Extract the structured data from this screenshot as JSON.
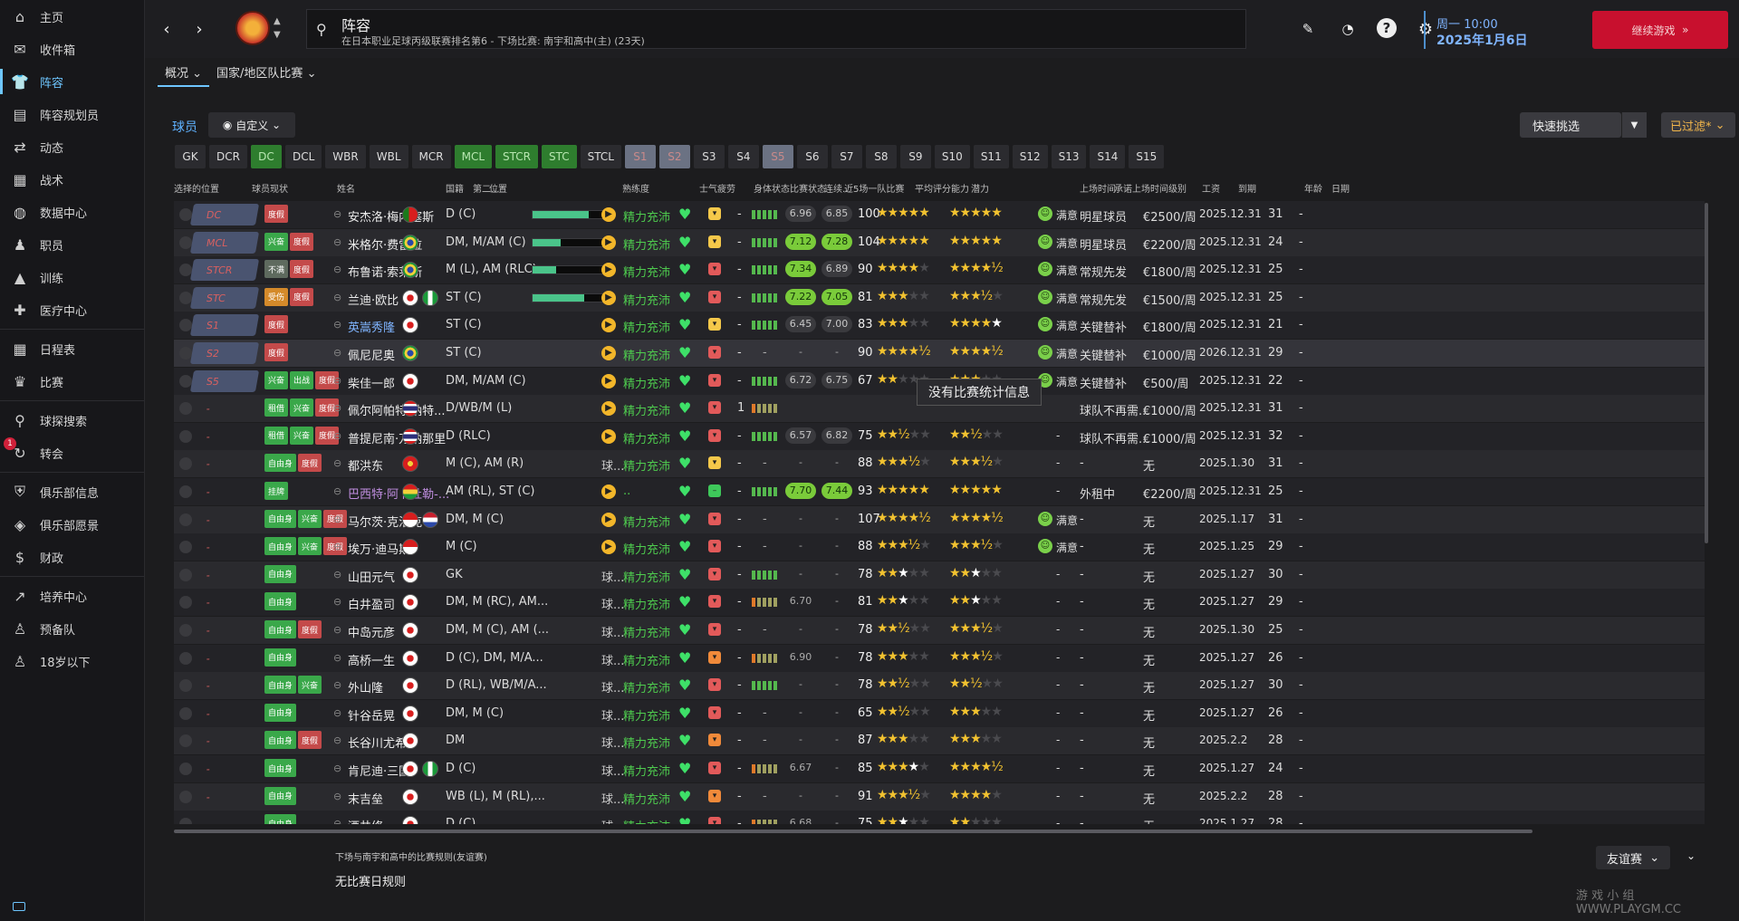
{
  "sidebar": {
    "items": [
      {
        "label": "主页",
        "icon": "home-icon"
      },
      {
        "label": "收件箱",
        "icon": "inbox-icon"
      },
      {
        "label": "阵容",
        "icon": "shirt-icon",
        "active": true
      },
      {
        "label": "阵容规划员",
        "icon": "clipboard-icon"
      },
      {
        "label": "动态",
        "icon": "dynamics-icon"
      },
      {
        "label": "战术",
        "icon": "tactics-icon"
      },
      {
        "label": "数据中心",
        "icon": "data-icon"
      },
      {
        "label": "职员",
        "icon": "staff-icon"
      },
      {
        "label": "训练",
        "icon": "training-icon"
      },
      {
        "label": "医疗中心",
        "icon": "medical-icon"
      },
      {
        "label": "日程表",
        "icon": "calendar-icon"
      },
      {
        "label": "比赛",
        "icon": "trophy-icon"
      },
      {
        "label": "球探搜索",
        "icon": "search-icon"
      },
      {
        "label": "转会",
        "icon": "transfer-icon",
        "badge": "1"
      },
      {
        "label": "俱乐部信息",
        "icon": "shield-icon"
      },
      {
        "label": "俱乐部愿景",
        "icon": "vision-icon"
      },
      {
        "label": "财政",
        "icon": "finance-icon"
      },
      {
        "label": "培养中心",
        "icon": "development-icon"
      },
      {
        "label": "预备队",
        "icon": "reserve-icon"
      },
      {
        "label": "18岁以下",
        "icon": "u18-icon"
      }
    ]
  },
  "header": {
    "title": "阵容",
    "subtitle": "在日本职业足球丙级联赛排名第6 - 下场比赛: 南宇和高中(主) (23天)",
    "day_time": "周一 10:00",
    "date": "2025年1月6日",
    "continue": "继续游戏"
  },
  "tabs": [
    "概况",
    "国家/地区队比赛"
  ],
  "toolbar": {
    "players": "球员",
    "custom": "自定义",
    "quick_pick": "快速挑选",
    "filtered": "已过滤*"
  },
  "positions": [
    {
      "label": "GK",
      "state": "n"
    },
    {
      "label": "DCR",
      "state": "n"
    },
    {
      "label": "DC",
      "state": "g"
    },
    {
      "label": "DCL",
      "state": "n"
    },
    {
      "label": "WBR",
      "state": "n"
    },
    {
      "label": "WBL",
      "state": "n"
    },
    {
      "label": "MCR",
      "state": "n"
    },
    {
      "label": "MCL",
      "state": "g"
    },
    {
      "label": "STCR",
      "state": "g"
    },
    {
      "label": "STC",
      "state": "g"
    },
    {
      "label": "STCL",
      "state": "n"
    },
    {
      "label": "S1",
      "state": "r"
    },
    {
      "label": "S2",
      "state": "r"
    },
    {
      "label": "S3",
      "state": "n"
    },
    {
      "label": "S4",
      "state": "n"
    },
    {
      "label": "S5",
      "state": "r"
    },
    {
      "label": "S6",
      "state": "n"
    },
    {
      "label": "S7",
      "state": "n"
    },
    {
      "label": "S8",
      "state": "n"
    },
    {
      "label": "S9",
      "state": "n"
    },
    {
      "label": "S10",
      "state": "n"
    },
    {
      "label": "S11",
      "state": "n"
    },
    {
      "label": "S12",
      "state": "n"
    },
    {
      "label": "S13",
      "state": "n"
    },
    {
      "label": "S14",
      "state": "n"
    },
    {
      "label": "S15",
      "state": "n"
    }
  ],
  "columns": [
    "选择的位置",
    "球员现状",
    "姓名",
    "国籍",
    "第二...",
    "位置",
    "熟练度",
    "士气",
    "疲劳",
    "身体状态",
    "比赛状态",
    "连续...",
    "近5场一队比赛",
    "平均评分",
    "能力",
    "能力",
    "潜力",
    "上场时间",
    "承诺上场时间级别",
    "工资",
    "到期",
    "年龄",
    "日期"
  ],
  "players": [
    {
      "sel": "DC",
      "on": true,
      "tags": [
        [
          "度假",
          "red"
        ]
      ],
      "name": "安杰洛·梅内塞斯",
      "nc": "",
      "flag": "pt",
      "flag2": "",
      "pos": "D (C)",
      "fam": 70,
      "mood": "▶",
      "cond": "精力充沛",
      "ms": "y",
      "streak": "-",
      "form": 5,
      "r1": "6.96",
      "r1c": "ratn",
      "r2": "6.85",
      "r2c": "ratn",
      "ca": "100",
      "s1": "★★★★★",
      "s1e": "",
      "s2": "★★★★★",
      "s2e": "",
      "happy": "满意",
      "status": "明星球员",
      "wage": "€2500/周",
      "exp": "2025.12.31",
      "age": "31",
      "dt": "-"
    },
    {
      "sel": "MCL",
      "on": true,
      "tags": [
        [
          "兴奋",
          "grn"
        ],
        [
          "度假",
          "red"
        ]
      ],
      "name": "米格尔·费雷拉",
      "nc": "",
      "flag": "br",
      "flag2": "",
      "pos": "DM, M/AM (C)",
      "fam": 35,
      "mood": "▶",
      "cond": "精力充沛",
      "ms": "y",
      "streak": "-",
      "form": 5,
      "r1": "7.12",
      "r1c": "ratg",
      "r2": "7.28",
      "r2c": "ratg",
      "ca": "104",
      "s1": "★★★★★",
      "s1e": "",
      "s2": "★★★★★",
      "s2e": "",
      "happy": "满意",
      "status": "明星球员",
      "wage": "€2200/周",
      "exp": "2025.12.31",
      "age": "24",
      "dt": "-"
    },
    {
      "sel": "STCR",
      "on": true,
      "tags": [
        [
          "不满",
          "gry"
        ],
        [
          "度假",
          "red"
        ]
      ],
      "name": "布鲁诺·索莱斯",
      "nc": "",
      "flag": "br",
      "flag2": "",
      "pos": "M (L), AM (RLC)",
      "fam": 30,
      "mood": "▶",
      "cond": "精力充沛",
      "ms": "r",
      "streak": "-",
      "form": 5,
      "r1": "7.34",
      "r1c": "ratg",
      "r2": "6.89",
      "r2c": "ratn",
      "ca": "90",
      "s1": "★★★★",
      "s1e": "★",
      "s2": "★★★★½",
      "s2e": "",
      "happy": "满意",
      "status": "常规先发",
      "wage": "€1800/周",
      "exp": "2025.12.31",
      "age": "25",
      "dt": "-"
    },
    {
      "sel": "STC",
      "on": true,
      "tags": [
        [
          "受伤",
          "orn"
        ],
        [
          "度假",
          "red"
        ]
      ],
      "name": "兰迪·欧比",
      "nc": "",
      "flag": "jp",
      "flag2": "ng",
      "pos": "ST (C)",
      "fam": 65,
      "mood": "▶",
      "cond": "精力充沛",
      "ms": "r",
      "streak": "-",
      "form": 5,
      "r1": "7.22",
      "r1c": "ratg",
      "r2": "7.05",
      "r2c": "ratg",
      "ca": "81",
      "s1": "★★★",
      "s1e": "★★",
      "s2": "★★★½",
      "s2e": "★",
      "happy": "满意",
      "status": "常规先发",
      "wage": "€1500/周",
      "exp": "2025.12.31",
      "age": "25",
      "dt": "-"
    },
    {
      "sel": "S1",
      "on": true,
      "tags": [
        [
          "度假",
          "red"
        ]
      ],
      "name": "英嵩秀隆",
      "nc": "blue",
      "flag": "jp",
      "flag2": "",
      "pos": "ST (C)",
      "fam": 0,
      "mood": "▶",
      "cond": "精力充沛",
      "ms": "y",
      "streak": "-",
      "form": 5,
      "r1": "6.45",
      "r1c": "ratn",
      "r2": "7.00",
      "r2c": "ratn",
      "ca": "83",
      "s1": "★★★",
      "s1e": "★★",
      "s2": "★★★★",
      "s2e": "",
      "s2w": "★",
      "happy": "满意",
      "status": "关键替补",
      "wage": "€1800/周",
      "exp": "2025.12.31",
      "age": "21",
      "dt": "-"
    },
    {
      "sel": "S2",
      "on": true,
      "tags": [
        [
          "度假",
          "red"
        ]
      ],
      "name": "佩尼尼奥",
      "nc": "",
      "flag": "br",
      "flag2": "",
      "pos": "ST (C)",
      "fam": 0,
      "mood": "▶",
      "cond": "精力充沛",
      "ms": "r",
      "streak": "-",
      "form": 0,
      "r1": "-",
      "r1c": "ratd",
      "r2": "-",
      "r2c": "ratd",
      "ca": "90",
      "s1": "★★★★½",
      "s1e": "",
      "s2": "★★★★½",
      "s2e": "",
      "happy": "满意",
      "status": "关键替补",
      "wage": "€1000/周",
      "exp": "2026.12.31",
      "age": "29",
      "dt": "-"
    },
    {
      "sel": "S5",
      "on": true,
      "tags": [
        [
          "兴奋",
          "grn"
        ],
        [
          "出战",
          "grn"
        ],
        [
          "度假",
          "red"
        ]
      ],
      "name": "柴佳一郎",
      "nc": "",
      "flag": "jp",
      "flag2": "",
      "pos": "DM, M/AM (C)",
      "fam": 0,
      "mood": "▶",
      "cond": "精力充沛",
      "ms": "r",
      "streak": "-",
      "form": 5,
      "r1": "6.72",
      "r1c": "ratn",
      "r2": "6.75",
      "r2c": "ratn",
      "ca": "67",
      "s1": "★★",
      "s1e": "★★★",
      "s2": "★★★",
      "s2e": "★★",
      "happy": "满意",
      "status": "关键替补",
      "wage": "€500/周",
      "exp": "2025.12.31",
      "age": "22",
      "dt": "-"
    },
    {
      "sel": "-",
      "on": false,
      "tags": [
        [
          "租借",
          "grn"
        ],
        [
          "兴奋",
          "grn"
        ],
        [
          "度假",
          "red"
        ]
      ],
      "name": "佩尔阿帕特·纳特...",
      "nc": "",
      "flag": "th",
      "flag2": "",
      "pos": "D/WB/M (L)",
      "fam": 0,
      "mood": "▶",
      "cond": "精力充沛",
      "ms": "r",
      "streak": "1",
      "form": 5,
      "r1": "",
      "r1c": "ratd",
      "r2": "",
      "r2c": "ratd",
      "ca": "",
      "s1": "",
      "s1e": "",
      "s2": "",
      "s2e": "",
      "happy": "",
      "status": "球队不再需...",
      "wage": "€1000/周",
      "exp": "2025.12.31",
      "age": "31",
      "dt": "-"
    },
    {
      "sel": "-",
      "on": false,
      "tags": [
        [
          "租借",
          "grn"
        ],
        [
          "兴奋",
          "grn"
        ],
        [
          "度假",
          "red"
        ]
      ],
      "name": "普提尼南·万纳那里",
      "nc": "",
      "flag": "th",
      "flag2": "",
      "pos": "D (RLC)",
      "fam": 0,
      "mood": "▶",
      "cond": "精力充沛",
      "ms": "r",
      "streak": "-",
      "form": 5,
      "r1": "6.57",
      "r1c": "ratn",
      "r2": "6.82",
      "r2c": "ratn",
      "ca": "75",
      "s1": "★★½",
      "s1e": "★★",
      "s2": "★★½",
      "s2e": "★★",
      "happy": "-",
      "status": "球队不再需...",
      "wage": "€1000/周",
      "exp": "2025.12.31",
      "age": "32",
      "dt": "-"
    },
    {
      "sel": "-",
      "on": false,
      "tags": [
        [
          "自由身",
          "grn"
        ],
        [
          "度假",
          "red"
        ]
      ],
      "name": "都洪东",
      "nc": "",
      "flag": "vn",
      "flag2": "",
      "pos": "M (C), AM (R)",
      "fam": 0,
      "mood": "球...",
      "cond": "精力充沛",
      "ms": "y",
      "streak": "-",
      "form": 0,
      "r1": "-",
      "r1c": "ratd",
      "r2": "-",
      "r2c": "ratd",
      "ca": "88",
      "s1": "★★★½",
      "s1e": "★",
      "s2": "★★★½",
      "s2e": "★",
      "happy": "-",
      "status": "-",
      "wage": "无",
      "exp": "2025.1.30",
      "age": "31",
      "dt": "-"
    },
    {
      "sel": "-",
      "on": false,
      "tags": [
        [
          "挂牌",
          "grn"
        ]
      ],
      "name": "巴西特·阿卜杜勒-...",
      "nc": "purple",
      "flag": "gh",
      "flag2": "",
      "pos": "AM (RL), ST (C)",
      "fam": 0,
      "mood": "▶",
      "cond": "..",
      "ms": "g",
      "streak": "-",
      "form": 5,
      "r1": "7.70",
      "r1c": "ratg",
      "r2": "7.44",
      "r2c": "ratg",
      "ca": "93",
      "s1": "★★★★★",
      "s1e": "",
      "s2": "★★★★★",
      "s2e": "",
      "happy": "-",
      "status": "外租中",
      "wage": "€2200/周",
      "exp": "2025.12.31",
      "age": "25",
      "dt": "-"
    },
    {
      "sel": "-",
      "on": false,
      "tags": [
        [
          "自由身",
          "grn"
        ],
        [
          "兴奋",
          "grn"
        ],
        [
          "度假",
          "red"
        ]
      ],
      "name": "马尔茨·克洛克",
      "nc": "",
      "flag": "id",
      "flag2": "nl",
      "pos": "DM, M (C)",
      "fam": 0,
      "mood": "▶",
      "cond": "精力充沛",
      "ms": "r",
      "streak": "-",
      "form": 0,
      "r1": "-",
      "r1c": "ratd",
      "r2": "-",
      "r2c": "ratd",
      "ca": "107",
      "s1": "★★★★½",
      "s1e": "",
      "s2": "★★★★½",
      "s2e": "",
      "happy": "满意",
      "status": "-",
      "wage": "无",
      "exp": "2025.1.17",
      "age": "31",
      "dt": "-"
    },
    {
      "sel": "-",
      "on": false,
      "tags": [
        [
          "自由身",
          "grn"
        ],
        [
          "兴奋",
          "grn"
        ],
        [
          "度假",
          "red"
        ]
      ],
      "name": "埃万·迪马斯",
      "nc": "",
      "flag": "id",
      "flag2": "",
      "pos": "M (C)",
      "fam": 0,
      "mood": "▶",
      "cond": "精力充沛",
      "ms": "r",
      "streak": "-",
      "form": 0,
      "r1": "-",
      "r1c": "ratd",
      "r2": "-",
      "r2c": "ratd",
      "ca": "88",
      "s1": "★★★½",
      "s1e": "★",
      "s2": "★★★½",
      "s2e": "★",
      "happy": "满意",
      "status": "-",
      "wage": "无",
      "exp": "2025.1.25",
      "age": "29",
      "dt": "-"
    },
    {
      "sel": "-",
      "on": false,
      "tags": [
        [
          "自由身",
          "grn"
        ]
      ],
      "name": "山田元气",
      "nc": "",
      "flag": "jp",
      "flag2": "",
      "pos": "GK",
      "fam": 0,
      "mood": "球...",
      "cond": "精力充沛",
      "ms": "r",
      "streak": "-",
      "form": 5,
      "r1": "-",
      "r1c": "ratd",
      "r2": "-",
      "r2c": "ratd",
      "ca": "78",
      "s1": "★★",
      "s1e": "★★",
      "s1w": "★",
      "s2": "★★",
      "s2e": "★★",
      "s2w": "★",
      "happy": "-",
      "status": "-",
      "wage": "无",
      "exp": "2025.1.27",
      "age": "30",
      "dt": "-"
    },
    {
      "sel": "-",
      "on": false,
      "tags": [
        [
          "自由身",
          "grn"
        ]
      ],
      "name": "白井盈司",
      "nc": "",
      "flag": "jp",
      "flag2": "",
      "pos": "DM, M (RC), AM...",
      "fam": 0,
      "mood": "球...",
      "cond": "精力充沛",
      "ms": "r",
      "streak": "-",
      "form": 5,
      "r1": "6.70",
      "r1c": "ratd",
      "r2": "-",
      "r2c": "ratd",
      "ca": "81",
      "s1": "★★",
      "s1e": "★★",
      "s1w": "★",
      "s2": "★★",
      "s2e": "★★",
      "s2w": "★",
      "happy": "-",
      "status": "-",
      "wage": "无",
      "exp": "2025.1.27",
      "age": "29",
      "dt": "-"
    },
    {
      "sel": "-",
      "on": false,
      "tags": [
        [
          "自由身",
          "grn"
        ],
        [
          "度假",
          "red"
        ]
      ],
      "name": "中岛元彦",
      "nc": "",
      "flag": "jp",
      "flag2": "",
      "pos": "DM, M (C), AM (...",
      "fam": 0,
      "mood": "球...",
      "cond": "精力充沛",
      "ms": "r",
      "streak": "-",
      "form": 0,
      "r1": "-",
      "r1c": "ratd",
      "r2": "-",
      "r2c": "ratd",
      "ca": "78",
      "s1": "★★½",
      "s1e": "★★",
      "s2": "★★★½",
      "s2e": "★",
      "happy": "-",
      "status": "-",
      "wage": "无",
      "exp": "2025.1.30",
      "age": "25",
      "dt": "-"
    },
    {
      "sel": "-",
      "on": false,
      "tags": [
        [
          "自由身",
          "grn"
        ]
      ],
      "name": "高桥一生",
      "nc": "",
      "flag": "jp",
      "flag2": "",
      "pos": "D (C), DM, M/A...",
      "fam": 0,
      "mood": "球...",
      "cond": "精力充沛",
      "ms": "o",
      "streak": "-",
      "form": 5,
      "r1": "6.90",
      "r1c": "ratd",
      "r2": "-",
      "r2c": "ratd",
      "ca": "78",
      "s1": "★★★",
      "s1e": "★★",
      "s2": "★★★½",
      "s2e": "★",
      "happy": "-",
      "status": "-",
      "wage": "无",
      "exp": "2025.1.27",
      "age": "26",
      "dt": "-"
    },
    {
      "sel": "-",
      "on": false,
      "tags": [
        [
          "自由身",
          "grn"
        ],
        [
          "兴奋",
          "grn"
        ]
      ],
      "name": "外山隆",
      "nc": "",
      "flag": "jp",
      "flag2": "",
      "pos": "D (RL), WB/M/A...",
      "fam": 0,
      "mood": "球...",
      "cond": "精力充沛",
      "ms": "r",
      "streak": "-",
      "form": 5,
      "r1": "-",
      "r1c": "ratd",
      "r2": "-",
      "r2c": "ratd",
      "ca": "78",
      "s1": "★★½",
      "s1e": "★★",
      "s2": "★★½",
      "s2e": "★★",
      "happy": "-",
      "status": "-",
      "wage": "无",
      "exp": "2025.1.27",
      "age": "30",
      "dt": "-"
    },
    {
      "sel": "-",
      "on": false,
      "tags": [
        [
          "自由身",
          "grn"
        ]
      ],
      "name": "针谷岳晃",
      "nc": "",
      "flag": "jp",
      "flag2": "",
      "pos": "DM, M (C)",
      "fam": 0,
      "mood": "球...",
      "cond": "精力充沛",
      "ms": "r",
      "streak": "-",
      "form": 0,
      "r1": "-",
      "r1c": "ratd",
      "r2": "-",
      "r2c": "ratd",
      "ca": "65",
      "s1": "★★½",
      "s1e": "★★",
      "s2": "★★★",
      "s2e": "★★",
      "happy": "-",
      "status": "-",
      "wage": "无",
      "exp": "2025.1.27",
      "age": "26",
      "dt": "-"
    },
    {
      "sel": "-",
      "on": false,
      "tags": [
        [
          "自由身",
          "grn"
        ],
        [
          "度假",
          "red"
        ]
      ],
      "name": "长谷川尤希",
      "nc": "",
      "flag": "jp",
      "flag2": "",
      "pos": "DM",
      "fam": 0,
      "mood": "球...",
      "cond": "精力充沛",
      "ms": "o",
      "streak": "-",
      "form": 0,
      "r1": "-",
      "r1c": "ratd",
      "r2": "-",
      "r2c": "ratd",
      "ca": "87",
      "s1": "★★★",
      "s1e": "★★",
      "s2": "★★★",
      "s2e": "★★",
      "happy": "-",
      "status": "-",
      "wage": "无",
      "exp": "2025.2.2",
      "age": "28",
      "dt": "-"
    },
    {
      "sel": "-",
      "on": false,
      "tags": [
        [
          "自由身",
          "grn"
        ]
      ],
      "name": "肯尼迪·三国",
      "nc": "",
      "flag": "jp",
      "flag2": "ng",
      "pos": "D (C)",
      "fam": 0,
      "mood": "球...",
      "cond": "精力充沛",
      "ms": "r",
      "streak": "-",
      "form": 5,
      "r1": "6.67",
      "r1c": "ratd",
      "r2": "-",
      "r2c": "ratd",
      "ca": "85",
      "s1": "★★★",
      "s1e": "★",
      "s1w": "★",
      "s2": "★★★★½",
      "s2e": "",
      "happy": "-",
      "status": "-",
      "wage": "无",
      "exp": "2025.1.27",
      "age": "24",
      "dt": "-"
    },
    {
      "sel": "-",
      "on": false,
      "tags": [
        [
          "自由身",
          "grn"
        ]
      ],
      "name": "末吉垒",
      "nc": "",
      "flag": "jp",
      "flag2": "",
      "pos": "WB (L), M (RL),...",
      "fam": 0,
      "mood": "球...",
      "cond": "精力充沛",
      "ms": "o",
      "streak": "-",
      "form": 0,
      "r1": "-",
      "r1c": "ratd",
      "r2": "-",
      "r2c": "ratd",
      "ca": "91",
      "s1": "★★★½",
      "s1e": "★",
      "s2": "★★★★",
      "s2e": "★",
      "happy": "-",
      "status": "-",
      "wage": "无",
      "exp": "2025.2.2",
      "age": "28",
      "dt": "-"
    },
    {
      "sel": "-",
      "on": false,
      "tags": [
        [
          "自由身",
          "grn"
        ]
      ],
      "name": "酒井修一",
      "nc": "",
      "flag": "jp",
      "flag2": "",
      "pos": "D (C)",
      "fam": 0,
      "mood": "球...",
      "cond": "精力充沛",
      "ms": "r",
      "streak": "-",
      "form": 5,
      "r1": "6.68",
      "r1c": "ratd",
      "r2": "-",
      "r2c": "ratd",
      "ca": "75",
      "s1": "★★",
      "s1e": "★★",
      "s1w": "★",
      "s2": "★★",
      "s2e": "★★★",
      "s2w": "",
      "happy": "-",
      "status": "-",
      "wage": "无",
      "exp": "2025.1.27",
      "age": "28",
      "dt": "-"
    }
  ],
  "tooltip": "没有比赛统计信息",
  "bottom": {
    "label": "下场与南宇和高中的比赛规则(友谊赛)",
    "value": "无比赛日规则",
    "friendly": "友谊赛"
  },
  "watermark": "游 戏 小 组 WWW.PLAYGM.CC"
}
